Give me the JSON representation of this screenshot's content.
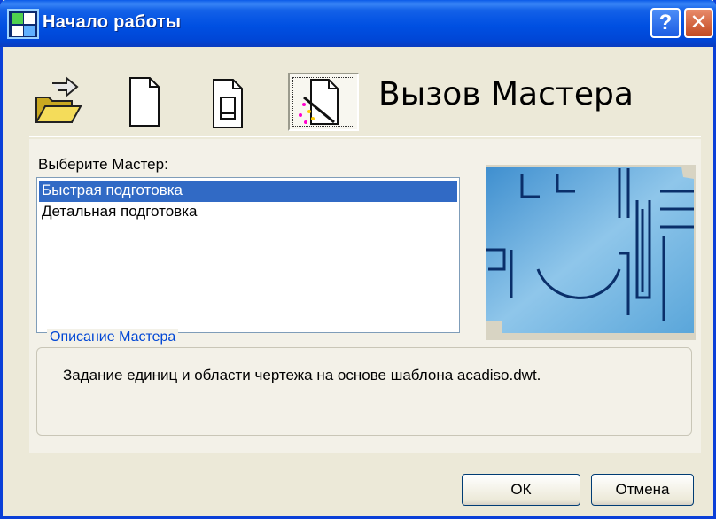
{
  "window": {
    "title": "Начало работы"
  },
  "toolbar": {
    "icons": [
      "open-drawing-icon",
      "start-from-scratch-icon",
      "use-template-icon",
      "wizard-icon"
    ],
    "heading": "Вызов Мастера"
  },
  "wizard": {
    "list_label": "Выберите Мастер:",
    "items": [
      "Быстрая подготовка",
      "Детальная подготовка"
    ],
    "selected_index": 0
  },
  "description": {
    "legend": "Описание Мастера",
    "text": "Задание единиц и области чертежа на основе шаблона acadiso.dwt."
  },
  "buttons": {
    "ok": "ОК",
    "cancel": "Отмена",
    "help": "?",
    "close": "✕"
  },
  "colors": {
    "titlebar": "#0050e2",
    "selection": "#316ac5",
    "legend": "#0046d5",
    "dialog_bg": "#ece9d8"
  }
}
